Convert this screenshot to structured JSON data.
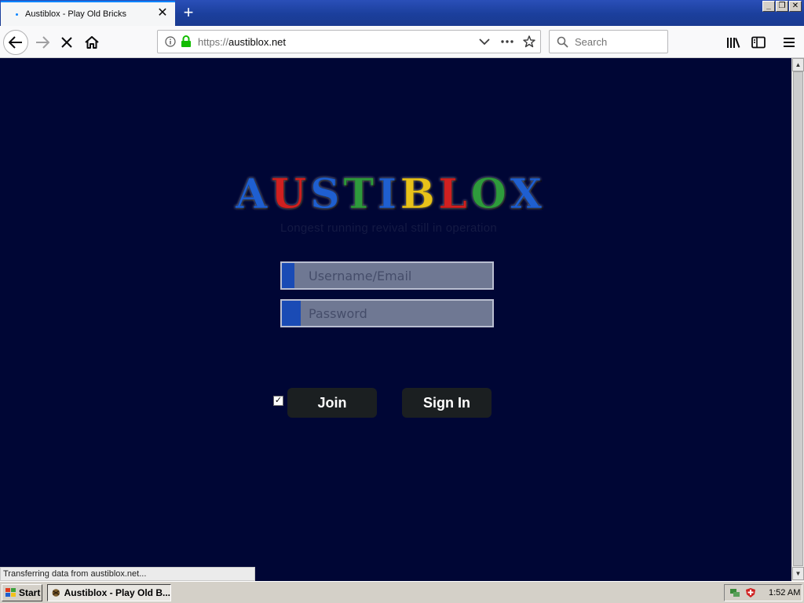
{
  "browser": {
    "tab_title": "Austiblox - Play Old Bricks",
    "close_tab_glyph": "✕",
    "new_tab_glyph": "+",
    "url_scheme": "https://",
    "url_host": "austiblox.net",
    "search_placeholder": "Search",
    "window_controls": [
      "_",
      "❐",
      "✕"
    ],
    "icons": [
      "back-arrow-icon",
      "forward-arrow-icon",
      "stop-icon",
      "home-icon",
      "info-icon",
      "lock-icon",
      "dropdown-icon",
      "page-actions-icon",
      "bookmark-star-icon",
      "search-icon",
      "library-icon",
      "sidebar-icon",
      "menu-icon"
    ]
  },
  "page": {
    "logo_letters": [
      "A",
      "U",
      "S",
      "T",
      "I",
      "B",
      "L",
      "O",
      "X"
    ],
    "logo_colors": [
      "#1f5fd0",
      "#d02020",
      "#1f5fd0",
      "#2e9a3c",
      "#1f5fd0",
      "#e8c21a",
      "#d02020",
      "#2e9a3c",
      "#1f5fd0",
      "#e8c21a"
    ],
    "tagline": "Longest running revival still in operation",
    "username_placeholder": "Username/Email",
    "password_placeholder": "Password",
    "remember_checked": true,
    "join_label": "Join",
    "signin_label": "Sign In",
    "background_color": "#000635"
  },
  "status": {
    "text": "Transferring data from austiblox.net..."
  },
  "taskbar": {
    "start_label": "Start",
    "task_label": "Austiblox - Play Old B...",
    "clock": "1:52 AM"
  }
}
